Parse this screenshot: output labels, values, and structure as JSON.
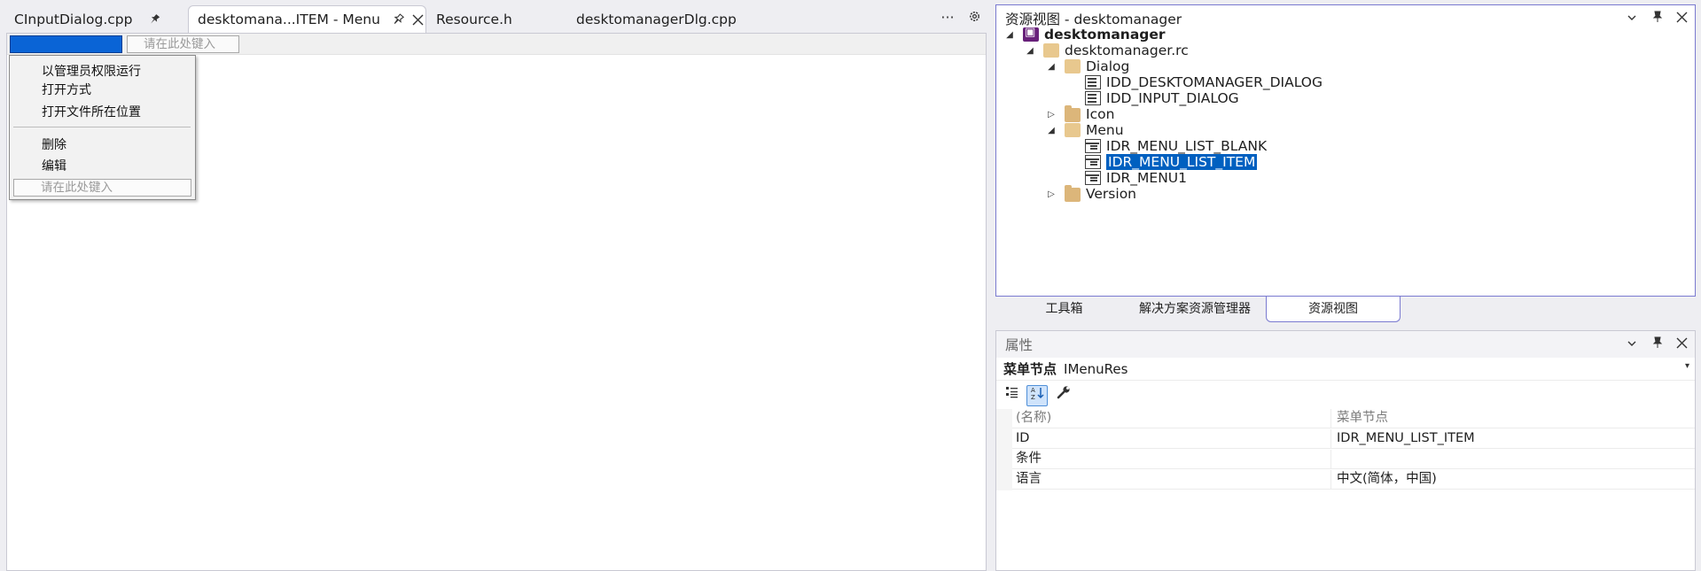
{
  "editor": {
    "tabs": [
      {
        "label": "CInputDialog.cpp"
      },
      {
        "label": "desktomana...ITEM - Menu"
      },
      {
        "label": "Resource.h"
      },
      {
        "label": "desktomanagerDlg.cpp"
      }
    ],
    "overflow_glyph": "···",
    "settings_glyph": "⚙",
    "menu_bar": {
      "new_item_placeholder": "请在此处键入"
    },
    "dropdown": {
      "items": [
        "以管理员权限运行",
        "打开方式",
        "打开文件所在位置",
        "删除",
        "编辑"
      ],
      "new_item_placeholder": "请在此处键入"
    }
  },
  "resource_view": {
    "title": "资源视图 - desktomanager",
    "tree": {
      "project": "desktomanager",
      "rc_file": "desktomanager.rc",
      "dialog_folder": "Dialog",
      "dialogs": [
        "IDD_DESKTOMANAGER_DIALOG",
        "IDD_INPUT_DIALOG"
      ],
      "icon_folder": "Icon",
      "menu_folder": "Menu",
      "menus": [
        "IDR_MENU_LIST_BLANK",
        "IDR_MENU_LIST_ITEM",
        "IDR_MENU1"
      ],
      "version_folder": "Version"
    }
  },
  "tool_tabs": {
    "toolbox": "工具箱",
    "solution_explorer": "解决方案资源管理器",
    "resource_view": "资源视图"
  },
  "properties": {
    "title": "属性",
    "object_type": "菜单节点",
    "object_name": "IMenuRes",
    "rows": [
      {
        "key": "(名称)",
        "value": "菜单节点"
      },
      {
        "key": "ID",
        "value": "IDR_MENU_LIST_ITEM"
      },
      {
        "key": "条件",
        "value": ""
      },
      {
        "key": "语言",
        "value": "中文(简体，中国)"
      }
    ]
  },
  "colors": {
    "selection": "#0060c0",
    "active_border": "#7a7ad0",
    "folder": "#dcb67a",
    "project_icon": "#68217a"
  }
}
